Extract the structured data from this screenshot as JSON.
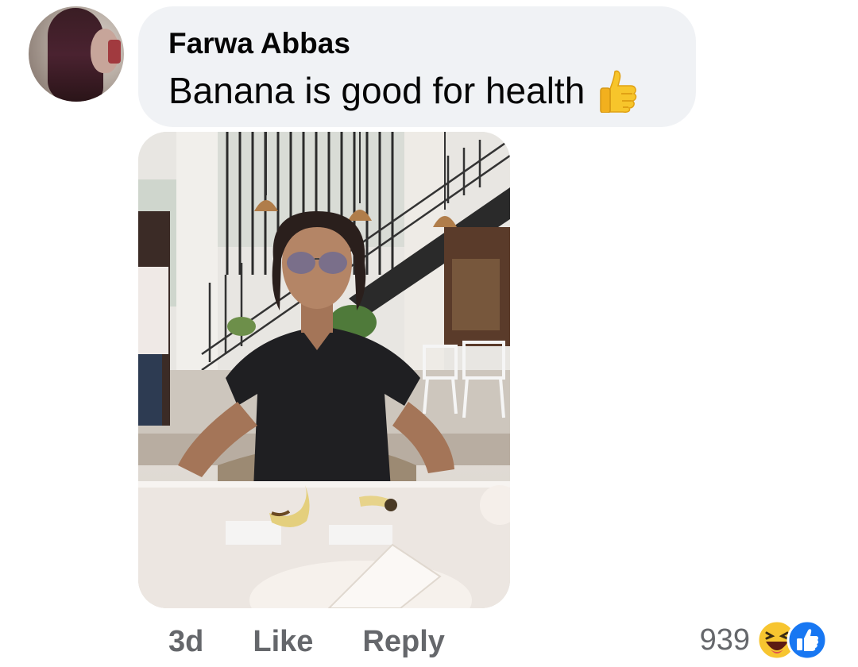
{
  "comment": {
    "author": "Farwa Abbas",
    "text": "Banana is good for health",
    "text_emoji": "thumbs-up-icon",
    "avatar_icon": "avatar"
  },
  "attachment": {
    "type": "photo"
  },
  "footer": {
    "timestamp": "3d",
    "like_label": "Like",
    "reply_label": "Reply",
    "reaction_count": "939",
    "reactions": [
      "laughing-face-icon",
      "like-reaction-icon"
    ]
  },
  "colors": {
    "bubble_bg": "#f0f2f5",
    "secondary_text": "#65676b",
    "primary_text": "#050505",
    "like_blue": "#1877f2"
  }
}
